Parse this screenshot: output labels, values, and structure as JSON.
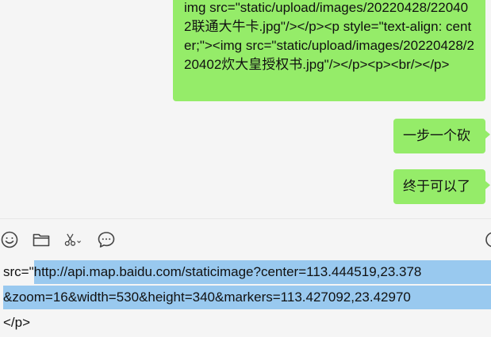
{
  "messages": [
    {
      "text": "img src=\"static/upload/images/20220428/220402联通大牛卡.jpg\"/></p><p style=\"text-align: center;\"><img src=\"static/upload/images/20220428/220402炊大皇授权书.jpg\"/></p><p><br/></p>"
    },
    {
      "text": "一步一个砍"
    },
    {
      "text": "终于可以了"
    }
  ],
  "toolbar": {
    "icons": [
      "emoji-icon",
      "folder-icon",
      "scissors-icon",
      "chat-icon",
      "history-icon"
    ]
  },
  "editor": {
    "line1_prefix": "src=\"",
    "line1_selected": "http://api.map.baidu.com/staticimage?center=113.444519,23.378",
    "line2_selected": "&zoom=16&width=530&height=340&markers=113.427092,23.42970",
    "line3": "</p>"
  },
  "colors": {
    "bubble": "#95ec69",
    "background": "#f5f5f5",
    "selection": "#99c9ef"
  }
}
